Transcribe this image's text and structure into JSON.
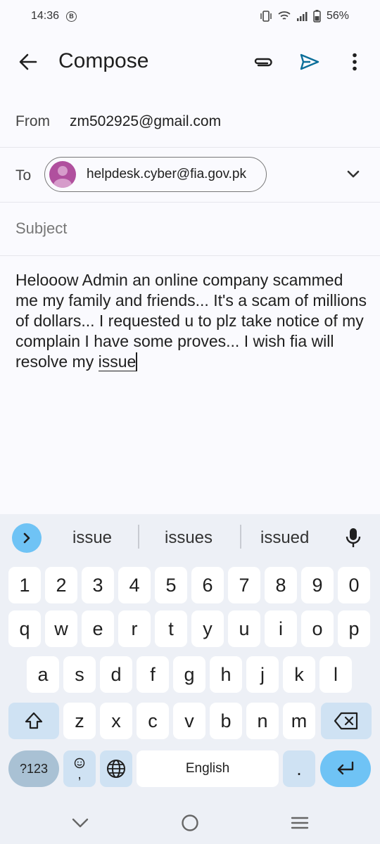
{
  "status_bar": {
    "time": "14:36",
    "b_icon": "B",
    "battery": "56%"
  },
  "appbar": {
    "title": "Compose",
    "icons": [
      "back-arrow-icon",
      "attach-icon",
      "send-icon",
      "more-vert-icon"
    ],
    "send_color": "#0b6e99"
  },
  "compose": {
    "from_label": "From",
    "from_value": "zm502925@gmail.com",
    "to_label": "To",
    "to_chip": "helpdesk.cyber@fia.gov.pk",
    "subject_placeholder": "Subject",
    "body_text": "Helooow Admin an online company scammed me my family and friends... It's a scam of millions of dollars... I requested u to plz take notice of my complain I have some proves... I wish fia will resolve my ",
    "body_cursor_word": "issue"
  },
  "keyboard": {
    "suggestions": [
      "issue",
      "issues",
      "issued"
    ],
    "numbers": [
      "1",
      "2",
      "3",
      "4",
      "5",
      "6",
      "7",
      "8",
      "9",
      "0"
    ],
    "row1": [
      "q",
      "w",
      "e",
      "r",
      "t",
      "y",
      "u",
      "i",
      "o",
      "p"
    ],
    "row2": [
      "a",
      "s",
      "d",
      "f",
      "g",
      "h",
      "j",
      "k",
      "l"
    ],
    "row3": [
      "z",
      "x",
      "c",
      "v",
      "b",
      "n",
      "m"
    ],
    "sym_key": "?123",
    "emoji_comma": ",",
    "space_label": "English",
    "period": ".",
    "accent_color": "#6fc3f5"
  }
}
